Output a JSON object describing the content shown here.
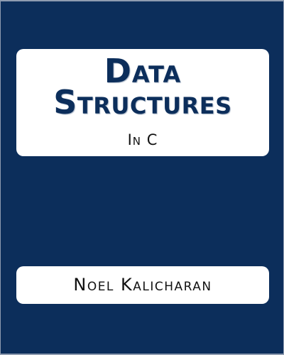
{
  "cover": {
    "title_line1": "Data",
    "title_line2": "Structures",
    "subtitle": "In C",
    "author": "Noel Kalicharan",
    "colors": {
      "background": "#0c2e5b",
      "panel": "#ffffff",
      "title_text": "#0c2e5b",
      "body_text": "#111111"
    }
  }
}
